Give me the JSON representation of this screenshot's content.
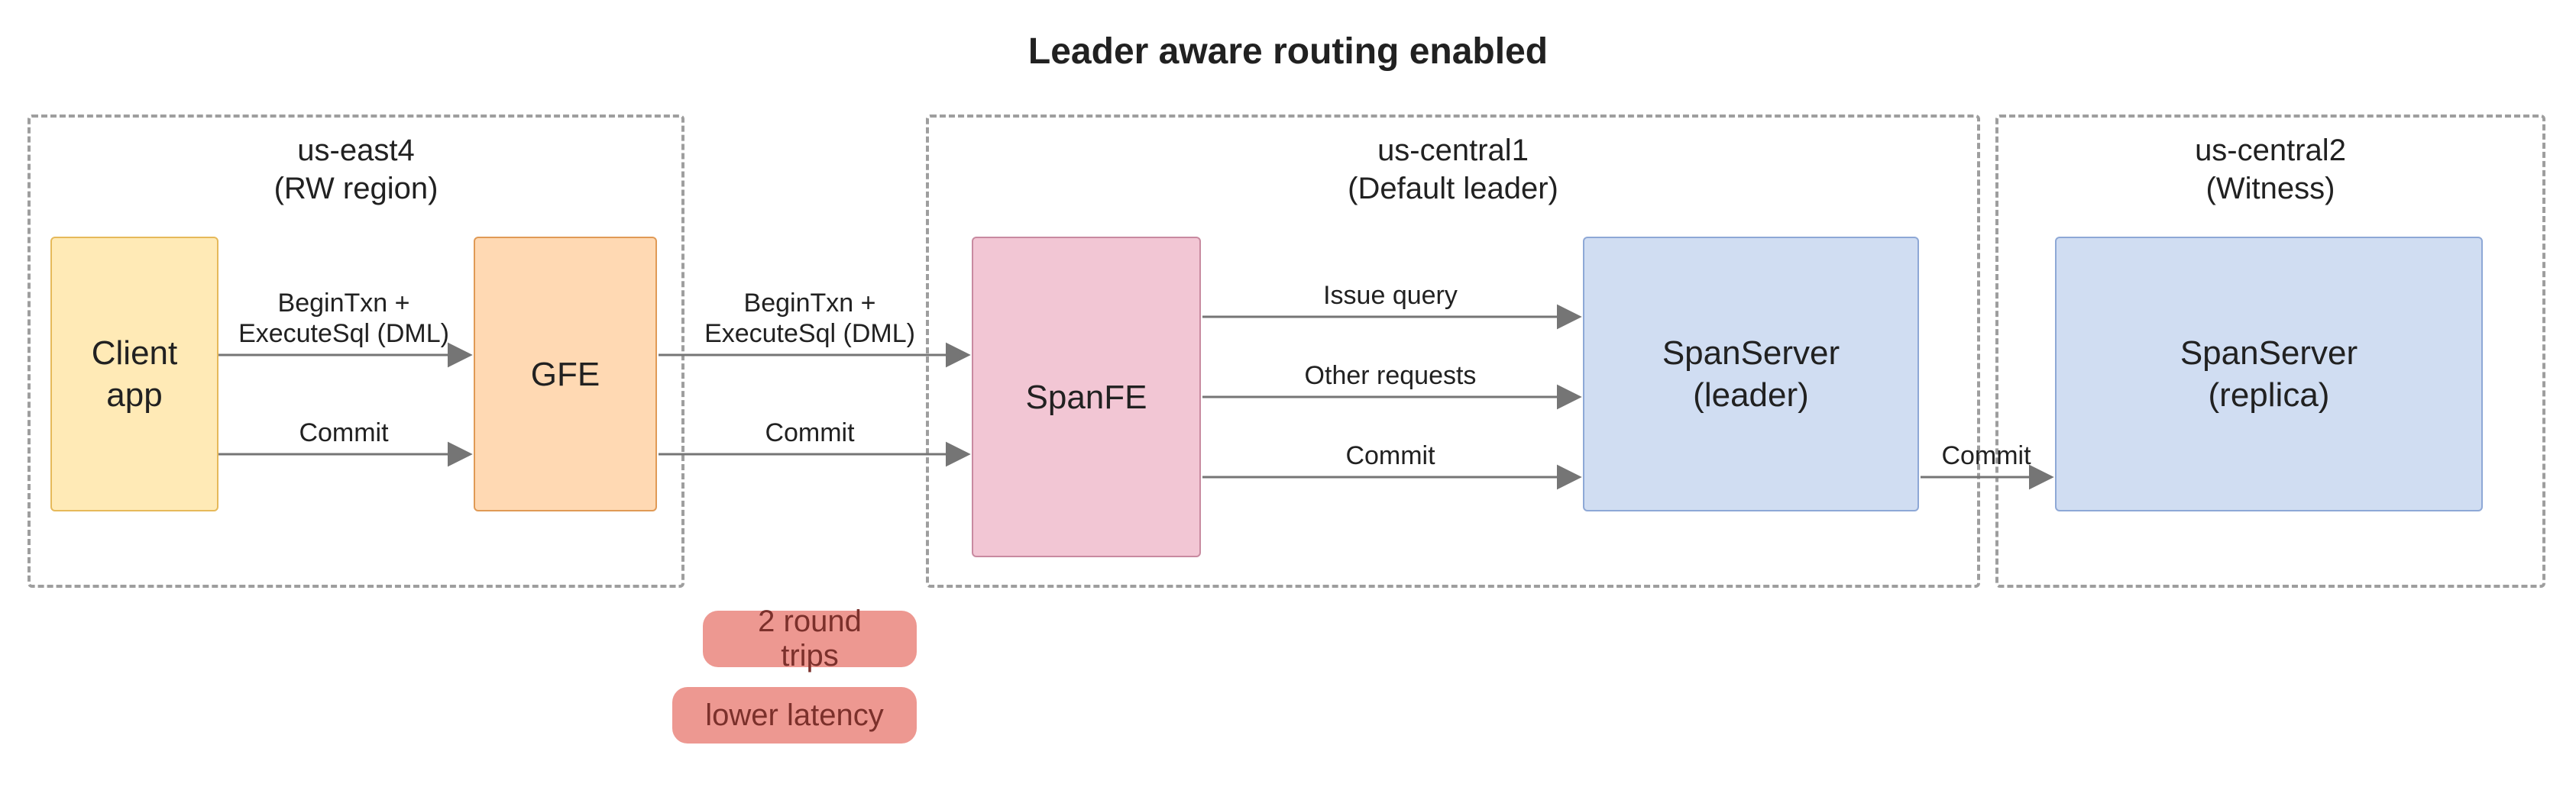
{
  "title": "Leader aware routing enabled",
  "regions": {
    "r1": {
      "name": "us-east4",
      "role": "(RW region)"
    },
    "r2": {
      "name": "us-central1",
      "role": "(Default leader)"
    },
    "r3": {
      "name": "us-central2",
      "role": "(Witness)"
    }
  },
  "boxes": {
    "client": {
      "label": "Client\napp"
    },
    "gfe": {
      "label": "GFE"
    },
    "spanfe": {
      "label": "SpanFE"
    },
    "spanserver_leader": {
      "label": "SpanServer\n(leader)"
    },
    "spanserver_replica": {
      "label": "SpanServer\n(replica)"
    }
  },
  "edges": {
    "e1": {
      "label_top": "BeginTxn +",
      "label_bot": "ExecuteSql (DML)"
    },
    "e2": {
      "label": "Commit"
    },
    "e3": {
      "label_top": "BeginTxn +",
      "label_bot": "ExecuteSql (DML)"
    },
    "e4": {
      "label": "Commit"
    },
    "e5": {
      "label": "Issue query"
    },
    "e6": {
      "label": "Other requests"
    },
    "e7": {
      "label": "Commit"
    },
    "e8": {
      "label": "Commit"
    }
  },
  "pills": {
    "p1": {
      "label": "2 round trips"
    },
    "p2": {
      "label": "lower latency"
    }
  },
  "colors": {
    "client_fill": "#ffeab6",
    "client_stroke": "#e6b95a",
    "gfe_fill": "#ffd9b3",
    "gfe_stroke": "#e09a56",
    "spanfe_fill": "#f2c6d4",
    "spanfe_stroke": "#c88aa0",
    "blue_fill": "#d0ddf2",
    "blue_stroke": "#8ea8d6",
    "pill_fill": "#ed9891",
    "pill_text": "#7b302b"
  }
}
